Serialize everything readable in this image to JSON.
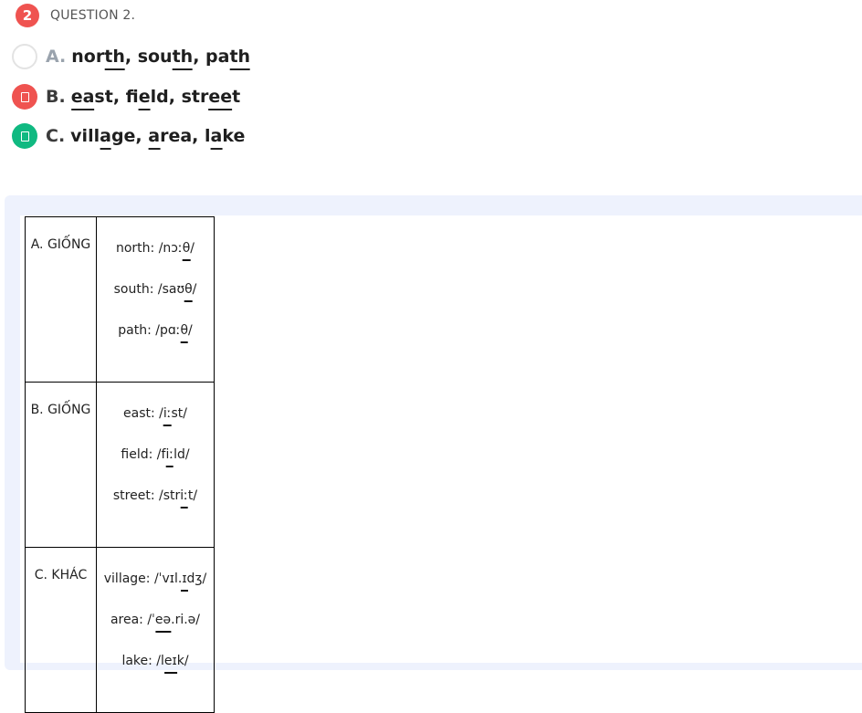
{
  "question": {
    "number": "2",
    "title": "QUESTION 2."
  },
  "options": [
    {
      "letter": "A.",
      "words": [
        {
          "pre": "nor",
          "ul": "th",
          "post": ", "
        },
        {
          "pre": "sou",
          "ul": "th",
          "post": ", "
        },
        {
          "pre": "pa",
          "ul": "th",
          "post": ""
        }
      ],
      "state": "unselected"
    },
    {
      "letter": "B.",
      "words": [
        {
          "pre": "",
          "ul": "ea",
          "post": "st, "
        },
        {
          "pre": "fi",
          "ul": "e",
          "post": "ld, "
        },
        {
          "pre": "str",
          "ul": "ee",
          "post": "t"
        }
      ],
      "state": "wrong"
    },
    {
      "letter": "C.",
      "words": [
        {
          "pre": "vill",
          "ul": "a",
          "post": "ge, "
        },
        {
          "pre": "",
          "ul": "a",
          "post": "rea, "
        },
        {
          "pre": "l",
          "ul": "a",
          "post": "ke"
        }
      ],
      "state": "correct"
    }
  ],
  "explanation": {
    "rows": [
      {
        "label": "A. GIỐNG",
        "lines": [
          {
            "pre": "north: /nɔː",
            "ul": "θ",
            "post": "/"
          },
          {
            "pre": "south: /saʊ",
            "ul": "θ",
            "post": "/"
          },
          {
            "pre": "path: /pɑː",
            "ul": "θ",
            "post": "/"
          }
        ]
      },
      {
        "label": "B. GIỐNG",
        "lines": [
          {
            "pre": "east: /",
            "ul": "iː",
            "post": "st/"
          },
          {
            "pre": "field: /f",
            "ul": "iː",
            "post": "ld/"
          },
          {
            "pre": "street: /str",
            "ul": "iː",
            "post": "t/"
          }
        ]
      },
      {
        "label": "C. KHÁC",
        "lines": [
          {
            "pre": "village: /ˈvɪl.",
            "ul": "ɪ",
            "post": "dʒ/"
          },
          {
            "pre": "area: /ˈ",
            "ul": "eə",
            "post": ".ri.ə/"
          },
          {
            "pre": "lake: /l",
            "ul": "eɪ",
            "post": "k/"
          }
        ]
      }
    ]
  }
}
